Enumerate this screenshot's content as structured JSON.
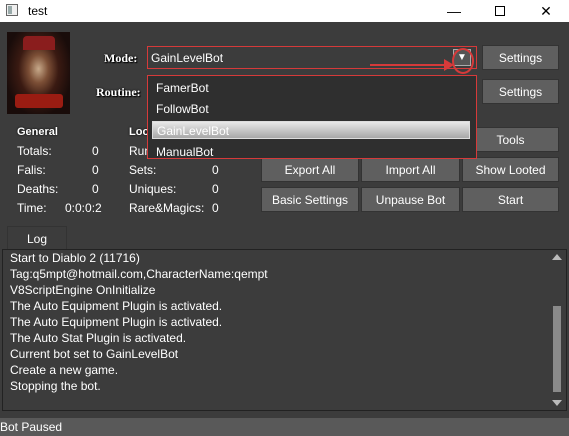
{
  "window": {
    "title": "test"
  },
  "labels": {
    "mode": "Mode:",
    "routine": "Routine:"
  },
  "mode_combo": {
    "value": "GainLevelBot",
    "options": [
      "FamerBot",
      "FollowBot",
      "GainLevelBot",
      "ManualBot"
    ],
    "selected": "GainLevelBot"
  },
  "buttons": {
    "settings_mode": "Settings",
    "settings_routine": "Settings",
    "tools": "Tools",
    "export_all": "Export All",
    "import_all": "Import All",
    "show_looted": "Show Looted",
    "basic_settings": "Basic Settings",
    "unpause_bot": "Unpause Bot",
    "start": "Start"
  },
  "general": {
    "header": "General",
    "rows": [
      {
        "label": "Totals:",
        "value": "0"
      },
      {
        "label": "Falis:",
        "value": "0"
      },
      {
        "label": "Deaths:",
        "value": "0"
      },
      {
        "label": "Time:",
        "value": "0:0:0:2"
      }
    ]
  },
  "loot": {
    "header": "Loo",
    "rows": [
      {
        "label": "Run",
        "value": ""
      },
      {
        "label": "Sets:",
        "value": "0"
      },
      {
        "label": "Uniques:",
        "value": "0"
      },
      {
        "label": "Rare&Magics:",
        "value": "0"
      }
    ]
  },
  "log": {
    "tab": "Log",
    "lines": [
      "Start to Diablo 2 (11716)",
      "Tag:q5mpt@hotmail.com,CharacterName:qempt",
      "V8ScriptEngine OnInitialize",
      "The Auto Equipment Plugin is activated.",
      "The Auto Equipment Plugin is activated.",
      "The Auto Stat Plugin is activated.",
      "Current bot set to GainLevelBot",
      "Create a new game.",
      "Stopping the bot."
    ]
  },
  "status": {
    "text": "Bot Paused"
  },
  "colors": {
    "annotation": "#d63a3a",
    "background": "#3c3c3c",
    "button": "#5f5f5f"
  }
}
